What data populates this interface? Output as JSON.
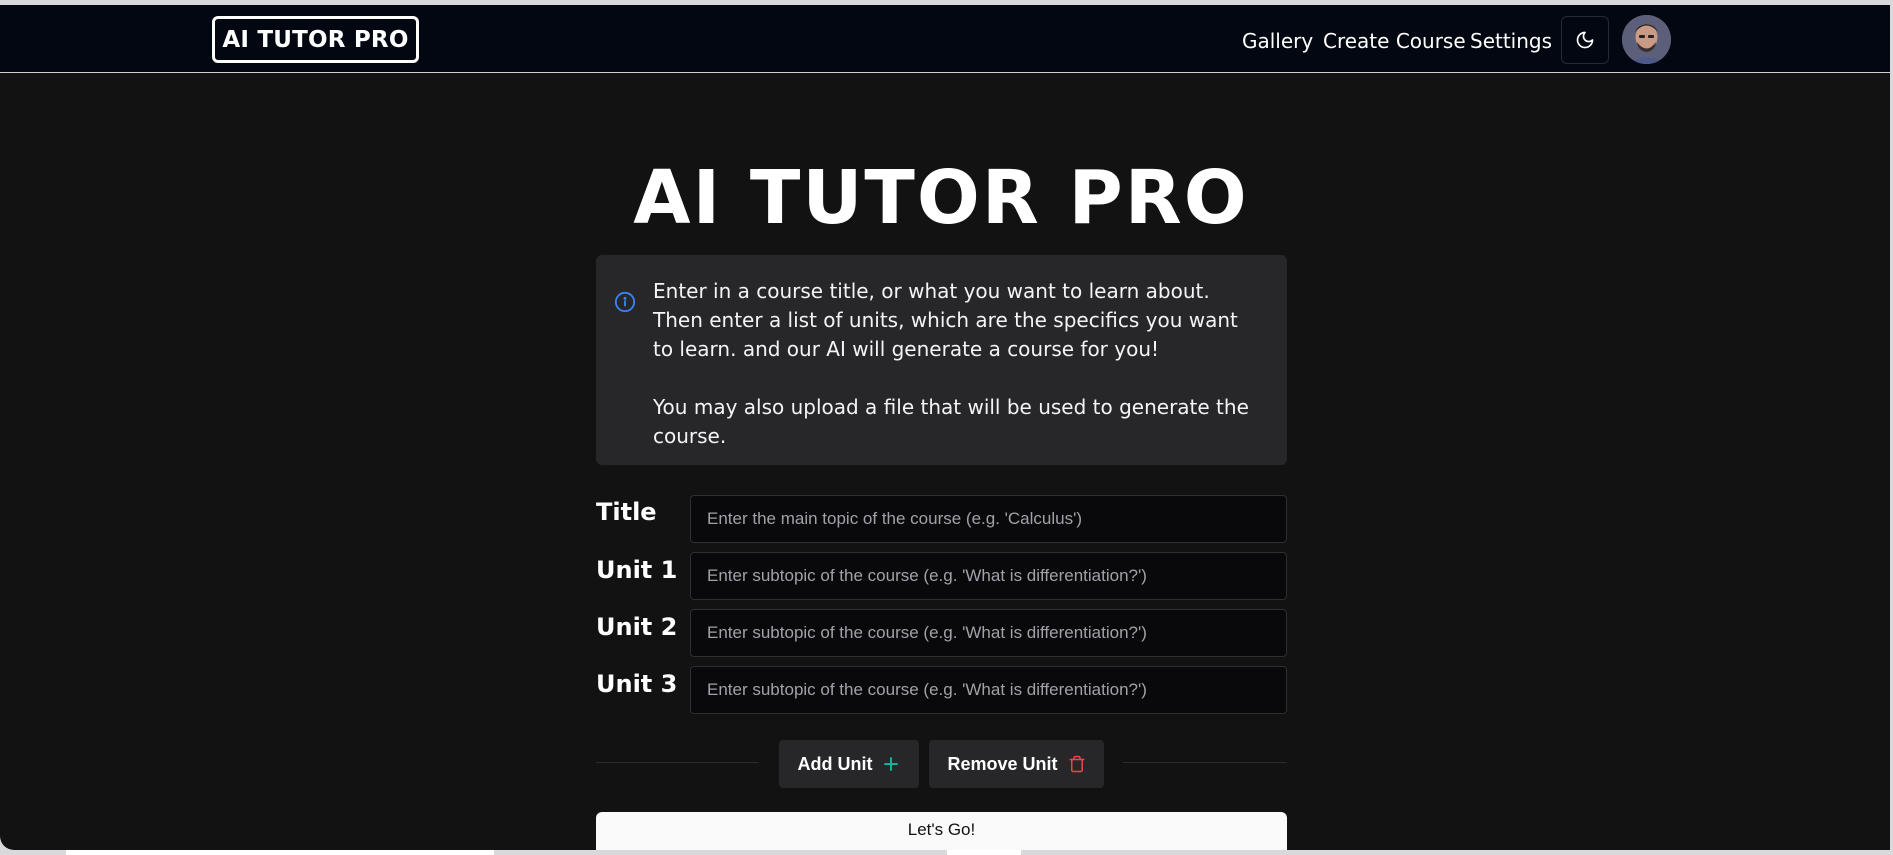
{
  "header": {
    "logo_text": "AI TUTOR PRO",
    "nav": {
      "gallery": "Gallery",
      "create_course": "Create Course",
      "settings": "Settings"
    },
    "theme_toggle_icon": "moon-icon",
    "avatar_icon": "user-avatar"
  },
  "main": {
    "title": "AI TUTOR PRO",
    "info": {
      "icon": "info-icon",
      "paragraph1": "Enter in a course title, or what you want to learn about. Then enter a list of units, which are the specifics you want to learn. and our AI will generate a course for you!",
      "paragraph2": "You may also upload a file that will be used to generate the course."
    },
    "form": {
      "title_label": "Title",
      "title_placeholder": "Enter the main topic of the course (e.g. 'Calculus')",
      "unit1_label": "Unit 1",
      "unit2_label": "Unit 2",
      "unit3_label": "Unit 3",
      "unit_placeholder": "Enter subtopic of the course (e.g. 'What is differentiation?')"
    },
    "buttons": {
      "add_unit": "Add Unit",
      "add_unit_icon": "plus-icon",
      "remove_unit": "Remove Unit",
      "remove_unit_icon": "trash-icon",
      "submit": "Let's Go!"
    }
  },
  "colors": {
    "background": "#121212",
    "navbar": "#020711",
    "info_icon": "#3b82f6",
    "plus_icon": "#14b8a6",
    "trash_icon": "#ef4444"
  }
}
